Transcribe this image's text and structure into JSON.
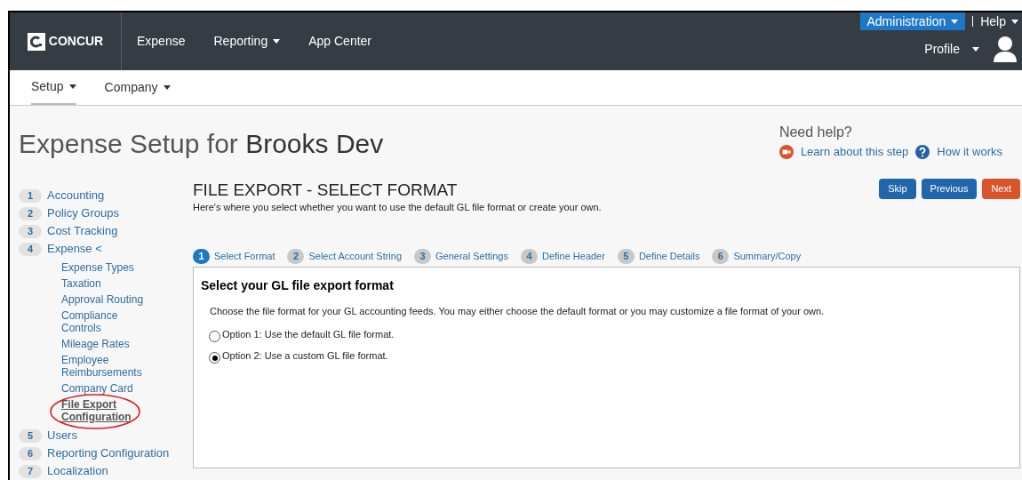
{
  "top_nav": {
    "logo": "CONCUR",
    "items": [
      {
        "label": "Expense",
        "dropdown": false
      },
      {
        "label": "Reporting",
        "dropdown": true
      },
      {
        "label": "App Center",
        "dropdown": false
      }
    ],
    "admin": "Administration",
    "help": "Help",
    "profile": "Profile"
  },
  "sub_nav": [
    {
      "label": "Setup",
      "selected": true
    },
    {
      "label": "Company",
      "selected": false
    }
  ],
  "page_title": {
    "lead": "Expense Setup for",
    "company": "Brooks Dev"
  },
  "help": {
    "title": "Need help?",
    "links": [
      "Learn about this step",
      "How it works"
    ]
  },
  "sidebar": [
    {
      "number": "1",
      "label": "Accounting"
    },
    {
      "number": "2",
      "label": "Policy Groups"
    },
    {
      "number": "3",
      "label": "Cost Tracking"
    },
    {
      "number": "4",
      "label": "Expense <",
      "children": [
        {
          "label": "Expense Types",
          "selected": false,
          "circled": false
        },
        {
          "label": "Taxation",
          "selected": false,
          "circled": false
        },
        {
          "label": "Approval Routing",
          "selected": false,
          "circled": false
        },
        {
          "label": "Compliance Controls",
          "selected": false,
          "circled": false
        },
        {
          "label": "Mileage Rates",
          "selected": false,
          "circled": false
        },
        {
          "label": "Employee Reimbursements",
          "selected": false,
          "circled": false
        },
        {
          "label": "Company Card",
          "selected": false,
          "circled": false
        },
        {
          "label": "File Export Configuration",
          "selected": true,
          "circled": true
        }
      ]
    },
    {
      "number": "5",
      "label": "Users"
    },
    {
      "number": "6",
      "label": "Reporting Configuration"
    },
    {
      "number": "7",
      "label": "Localization"
    }
  ],
  "section": {
    "title": "FILE EXPORT - SELECT FORMAT",
    "subtitle": "Here's where you select whether you want to use the default GL file format or create your own.",
    "buttons": [
      {
        "label": "Skip",
        "kind": "primary"
      },
      {
        "label": "Previous",
        "kind": "primary"
      },
      {
        "label": "Next",
        "kind": "accent"
      }
    ]
  },
  "steps": [
    {
      "number": "1",
      "label": "Select Format",
      "selected": true
    },
    {
      "number": "2",
      "label": "Select Account String",
      "selected": false
    },
    {
      "number": "3",
      "label": "General Settings",
      "selected": false
    },
    {
      "number": "4",
      "label": "Define Header",
      "selected": false
    },
    {
      "number": "5",
      "label": "Define Details",
      "selected": false
    },
    {
      "number": "6",
      "label": "Summary/Copy",
      "selected": false
    }
  ],
  "panel": {
    "heading": "Select your GL file export format",
    "description": "Choose the file format for your GL accounting feeds. You may either choose the default format or you may customize a file format of your own.",
    "options": [
      {
        "label": "Option 1: Use the default GL file format.",
        "selected": false
      },
      {
        "label": "Option 2: Use a custom GL file format.",
        "selected": true
      }
    ]
  }
}
